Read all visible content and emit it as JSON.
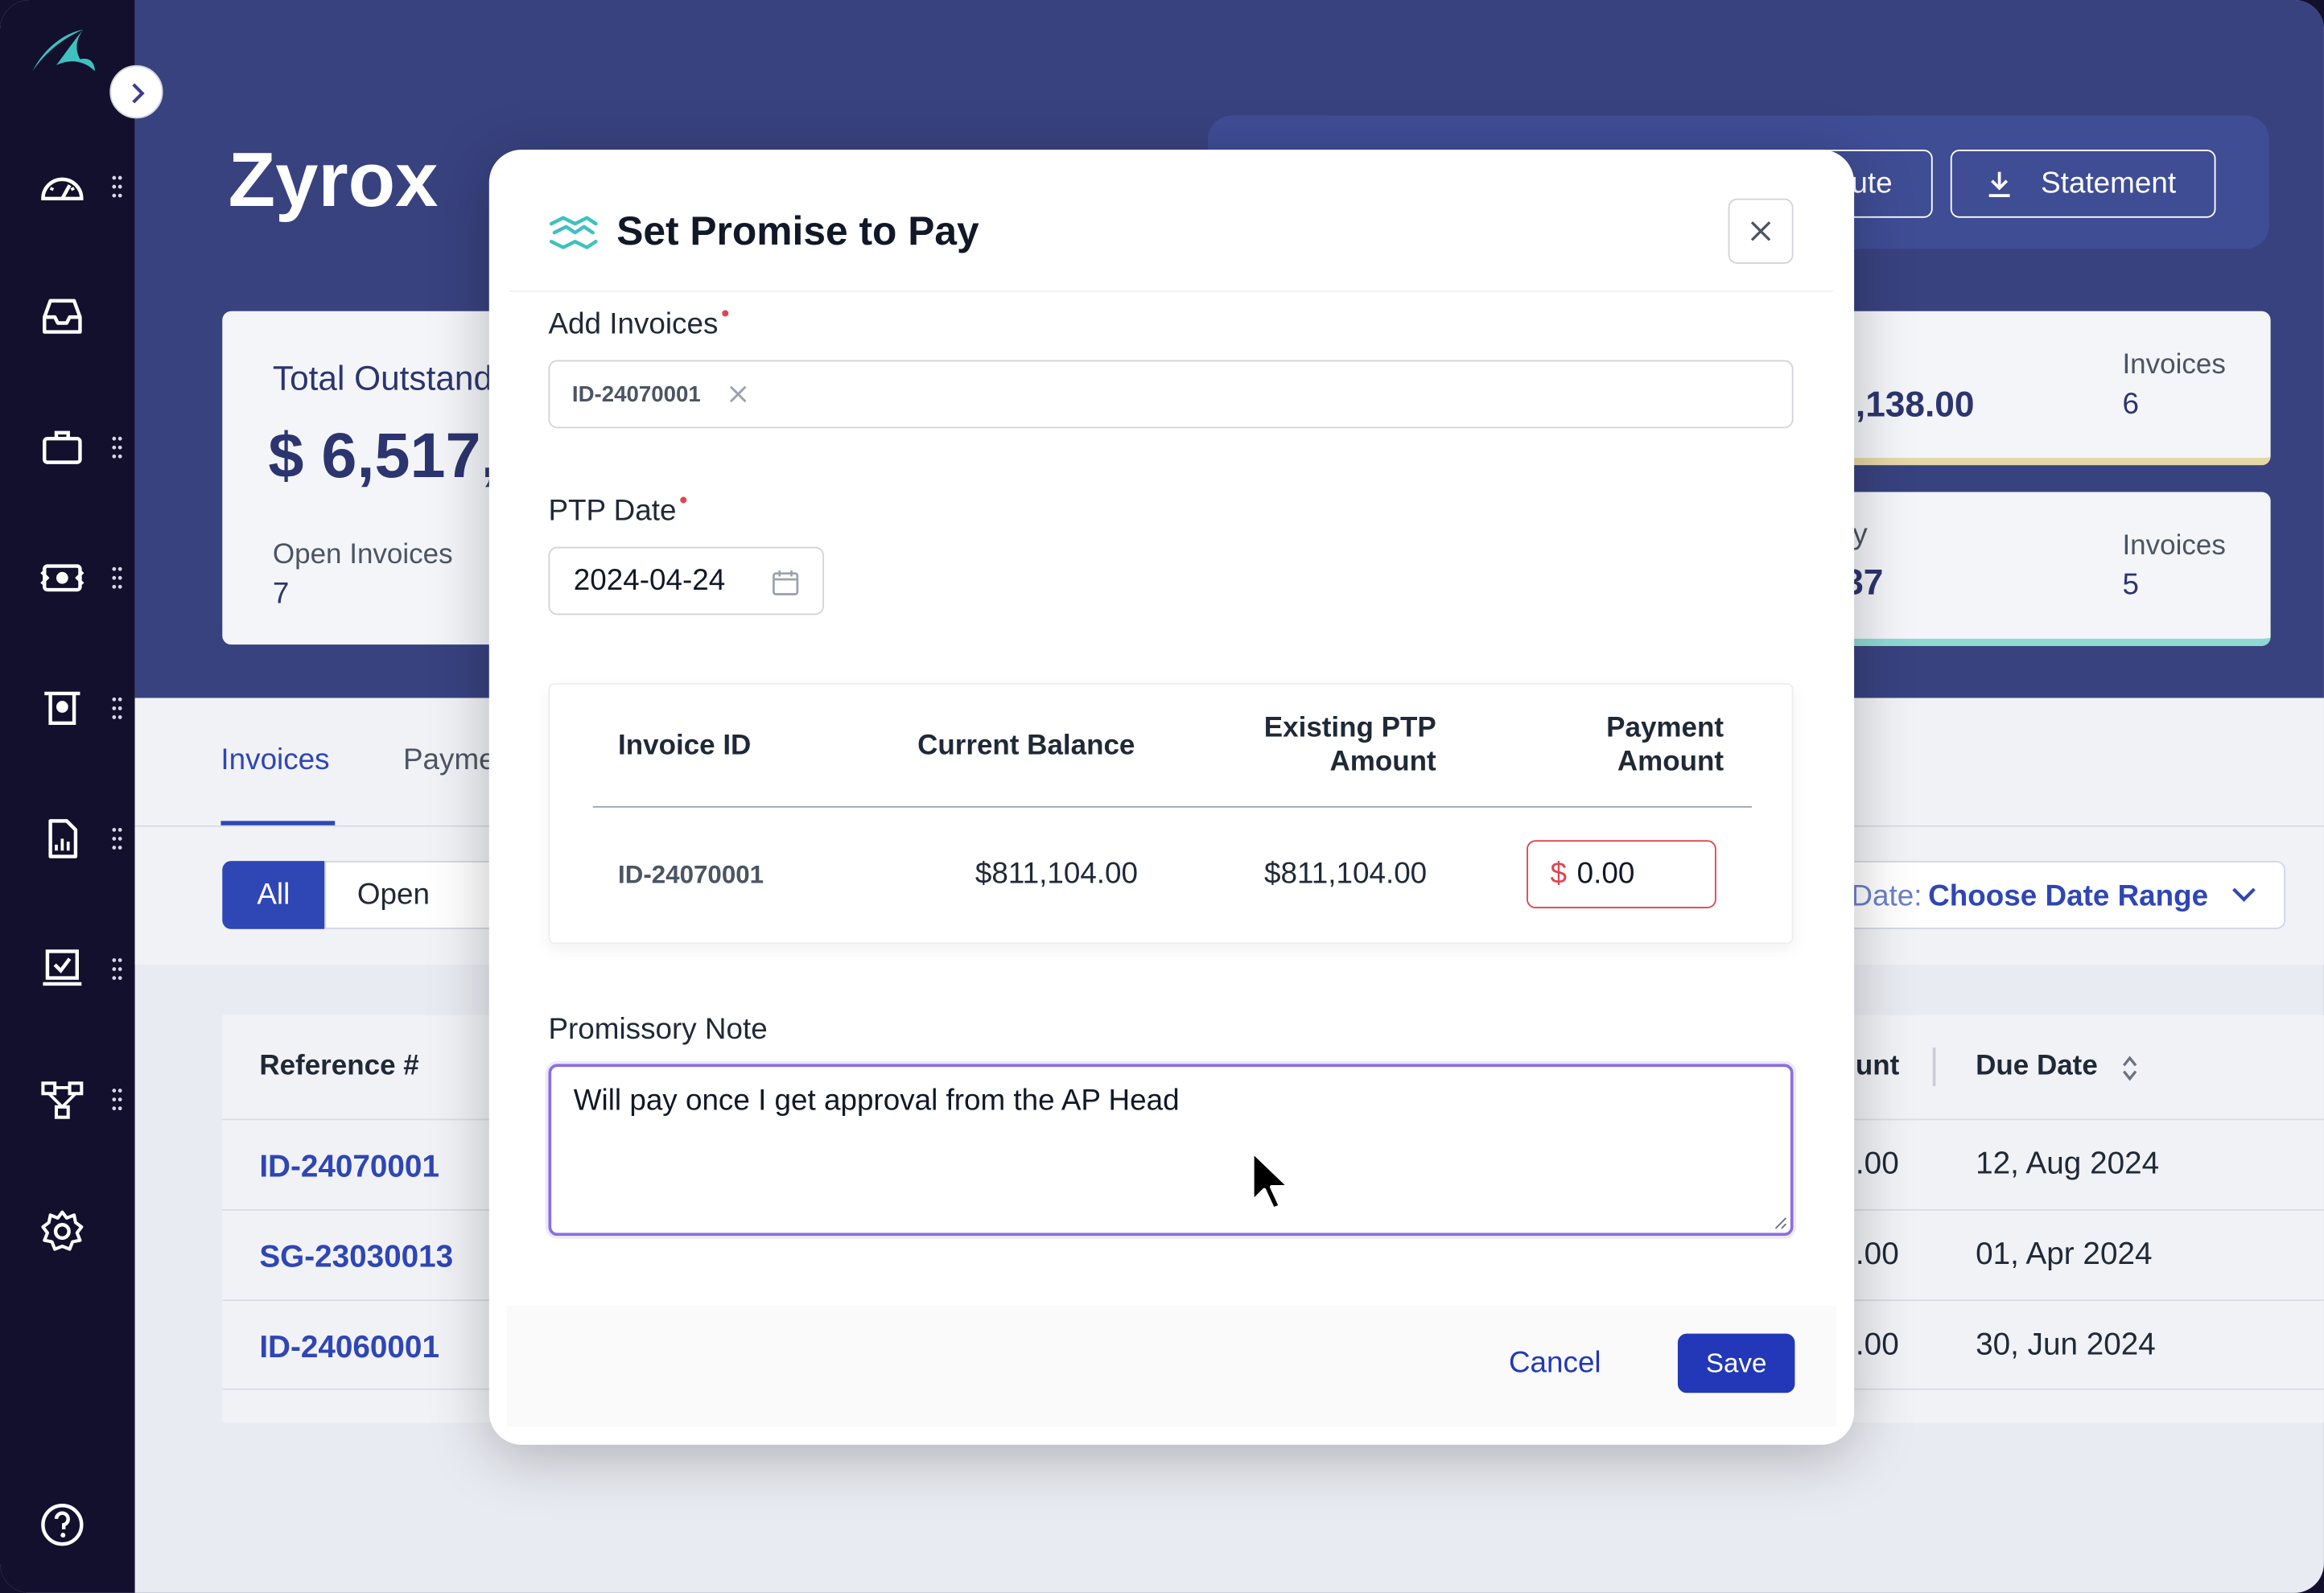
{
  "app": {
    "company_name": "Zyrox"
  },
  "header": {
    "dispute_label_partial": "ute",
    "statement_label": "Statement",
    "total_outstanding_label": "Total Outstand",
    "total_outstanding_value": "$ 6,517,",
    "open_invoices_label": "Open Invoices",
    "open_invoices_value": "7",
    "card_a_amount_partial": "),138.00",
    "card_a_invoices_label": "Invoices",
    "card_a_invoices_value": "6",
    "card_b_label_partial": "y",
    "card_b_amount_partial": "37",
    "card_b_invoices_label": "Invoices",
    "card_b_invoices_value": "5"
  },
  "tabs": {
    "invoices": "Invoices",
    "payments_partial": "Payme"
  },
  "filters": {
    "all": "All",
    "open": "Open",
    "date_prefix": "Date:",
    "date_value": "Choose Date Range"
  },
  "table": {
    "reference_header": "Reference #",
    "amount_header_partial": "unt",
    "due_date_header": "Due Date",
    "rows": [
      {
        "ref": "ID-24070001",
        "amount": ".00",
        "due": "12, Aug 2024"
      },
      {
        "ref": "SG-23030013",
        "amount": ".00",
        "due": "01, Apr 2024"
      },
      {
        "ref": "ID-24060001",
        "amount": ".00",
        "due": "30, Jun 2024"
      }
    ]
  },
  "modal": {
    "title": "Set Promise to Pay",
    "add_invoices_label": "Add Invoices",
    "invoice_chip": "ID-24070001",
    "ptp_date_label": "PTP Date",
    "ptp_date_value": "2024-04-24",
    "columns": {
      "invoice_id": "Invoice ID",
      "current_balance": "Current Balance",
      "existing_ptp_l1": "Existing PTP",
      "existing_ptp_l2": "Amount",
      "payment_l1": "Payment",
      "payment_l2": "Amount"
    },
    "row": {
      "invoice_id": "ID-24070001",
      "current_balance": "$811,104.00",
      "existing_ptp": "$811,104.00",
      "currency_symbol": "$",
      "payment_value": "0.00"
    },
    "promissory_label": "Promissory Note",
    "promissory_value": "Will pay once I get approval from the AP Head",
    "cancel_label": "Cancel",
    "save_label": "Save"
  },
  "colors": {
    "sidebar": "#13102e",
    "header": "#38427f",
    "accent": "#2238b8",
    "link": "#2f46b5",
    "error": "#e0454f",
    "teal": "#3fc1c0"
  },
  "icons": [
    "logo-icon",
    "expand-icon",
    "dashboard-icon",
    "inbox-icon",
    "briefcase-icon",
    "payments-icon",
    "receipt-icon",
    "report-icon",
    "checklist-icon",
    "workflow-icon",
    "settings-icon",
    "help-icon",
    "drag-handle-icon",
    "download-icon",
    "handshake-icon",
    "close-icon",
    "calendar-icon",
    "chevron-down-icon",
    "sort-icon",
    "cursor-icon"
  ]
}
